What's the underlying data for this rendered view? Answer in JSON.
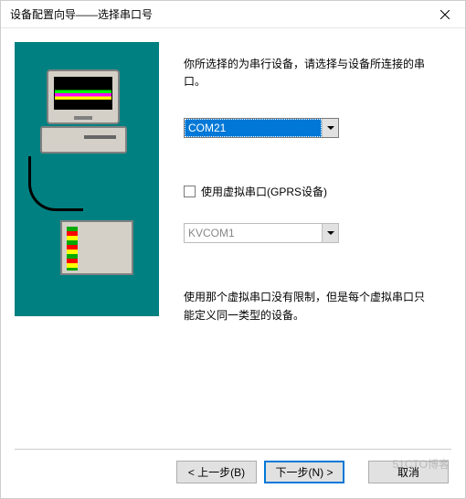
{
  "window": {
    "title": "设备配置向导——选择串口号"
  },
  "intro": "你所选择的为串行设备，请选择与设备所连接的串口。",
  "fields": {
    "com_port": {
      "value": "COM21"
    },
    "virtual_checkbox": {
      "label": "使用虚拟串口(GPRS设备)"
    },
    "virtual_port": {
      "value": "KVCOM1"
    }
  },
  "note": "使用那个虚拟串口没有限制，但是每个虚拟串口只能定义同一类型的设备。",
  "buttons": {
    "back": "< 上一步(B)",
    "next": "下一步(N) >",
    "cancel": "取消"
  },
  "watermark": "51CTO博客"
}
